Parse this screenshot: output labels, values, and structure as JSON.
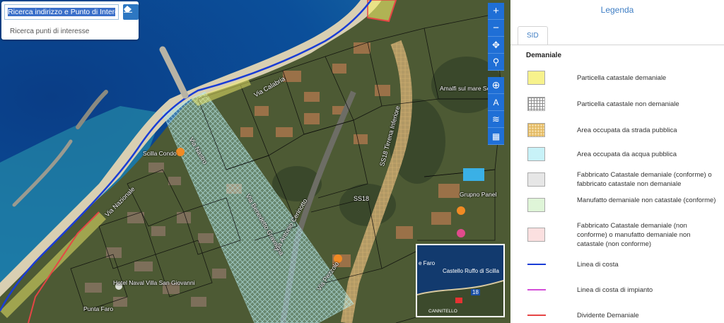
{
  "search": {
    "input_value": "Ricerca indirizzo e Punto di Interesse",
    "poi_link": "Ricerca punti di interesse"
  },
  "map": {
    "poi_labels": [
      "Scilla Condo",
      "Hotel Naval Villa San Giovanni",
      "Punta Faro",
      "Grupno Panel",
      "Amalfi sul mare Scilla"
    ],
    "street_labels": [
      "Via Nazionale",
      "Via Calabria",
      "Via Benedetto Gravagna",
      "Via Nastro",
      "SS18 Tirrena Inferiore",
      "SS18",
      "Via Antonio Cerinotto",
      "Via Pezzolo"
    ],
    "toolbar": [
      {
        "name": "zoom-in-icon",
        "glyph": "+"
      },
      {
        "name": "zoom-out-icon",
        "glyph": "−"
      },
      {
        "name": "pan-icon",
        "glyph": "✥"
      },
      {
        "name": "location-pin-icon",
        "glyph": "⚲"
      },
      {
        "name": "globe-icon",
        "glyph": "⊕"
      },
      {
        "name": "measure-icon",
        "glyph": "A"
      },
      {
        "name": "layers-icon",
        "glyph": "≋"
      },
      {
        "name": "map-icon",
        "glyph": "▦"
      }
    ],
    "minimap": {
      "place_label": "Castello Ruffo di Scilla",
      "corner_label": "e Faro",
      "bottom_label": "CANNITELLO",
      "badge": "18"
    }
  },
  "legend": {
    "title": "Legenda",
    "tab": "SID",
    "section": "Demaniale",
    "items": [
      {
        "label": "Particella catastale demaniale",
        "type": "fill",
        "color": "#f7f28c"
      },
      {
        "label": "Particella catastale non demaniale",
        "type": "grid",
        "color": "#8c8c8c"
      },
      {
        "label": "Area occupata da strada pubblica",
        "type": "grid",
        "color": "#e0b45a"
      },
      {
        "label": "Area occupata da acqua pubblica",
        "type": "fill",
        "color": "#c8f2f8"
      },
      {
        "label": "Fabbricato Catastale demaniale (conforme) o fabbricato catastale non demaniale",
        "type": "fill",
        "color": "#e6e6e6"
      },
      {
        "label": "Manufatto demaniale non catastale (conforme)",
        "type": "fill",
        "color": "#dff5d8"
      },
      {
        "label": "Fabbricato Catastale demaniale (non conforme) o manufatto demaniale non catastale (non conforme)",
        "type": "fill",
        "color": "#fbe0e0"
      },
      {
        "label": "Linea di costa",
        "type": "line",
        "color": "#1a3dd6"
      },
      {
        "label": "Linea di costa di impianto",
        "type": "line",
        "color": "#d34ed8"
      },
      {
        "label": "Dividente Demaniale",
        "type": "line",
        "color": "#e64545"
      }
    ]
  }
}
